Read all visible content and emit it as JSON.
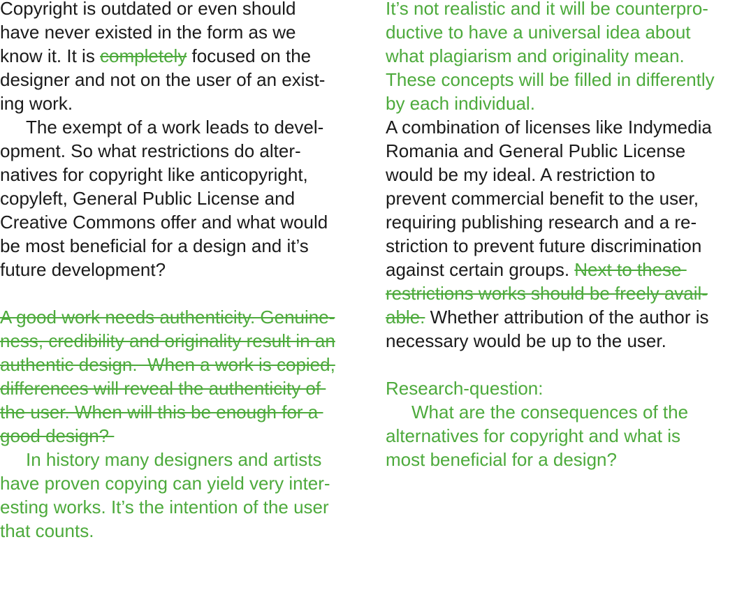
{
  "colors": {
    "body_text": "#1a1a1a",
    "annotation": "#4daa3c"
  },
  "left_column": {
    "p1": {
      "l1": "Copyright is outdated or even should",
      "l2": "have never existed in the form as we",
      "l3_pre": "know it. It is ",
      "l3_struck": "completely",
      "l3_post": " focused on the",
      "l4": "designer and not on the user of an exist-",
      "l5": "ing work."
    },
    "p2": {
      "l1": "The exempt of a work leads to devel-",
      "l2": "opment. So what restrictions do alter-",
      "l3": "natives for copyright like anticopyright,",
      "l4": "copyleft, General Public License and",
      "l5": "Creative Commons offer and what would",
      "l6": "be most beneficial for a design and it’s",
      "l7": "future development?"
    },
    "struck_para": {
      "l1": "A good work needs authenticity. Genuine-",
      "l2": "ness, credibility and originality result in an",
      "l3": "authentic design.  When a work is copied,",
      "l4": "differences will reveal the authenticity of ",
      "l5": "the user. When will this be enough for a ",
      "l6": "good design? "
    },
    "green_para": {
      "l1": "In history many designers and artists",
      "l2": "have proven copying can yield very inter-",
      "l3": "esting works. It’s the intention of the user",
      "l4": "that counts."
    }
  },
  "right_column": {
    "green_para": {
      "l1": "It’s not realistic and it will be counterpro-",
      "l2": "ductive to have a universal idea about",
      "l3": "what plagiarism and originality mean.",
      "l4": "These concepts will be filled in differently",
      "l5": "by each individual."
    },
    "p2": {
      "l1": "A combination of licenses like Indymedia",
      "l2": "Romania and General Public License",
      "l3": "would be my ideal. A restriction to",
      "l4": "prevent commercial benefit to the user,",
      "l5": "requiring publishing research and a re-",
      "l6": "striction to prevent future discrimination",
      "l7_pre": "against certain groups. ",
      "l7_struck": "Next to these ",
      "l8_struck": "restrictions works should be freely avail-",
      "l9_struck": "able.",
      "l9_post": " Whether attribution of the author is",
      "l10": "necessary would be up to the user."
    },
    "research": {
      "heading": "Research-question:",
      "l1": "What are the consequences of the",
      "l2": "alternatives for copyright and what is",
      "l3": "most beneficial for a design?"
    }
  }
}
